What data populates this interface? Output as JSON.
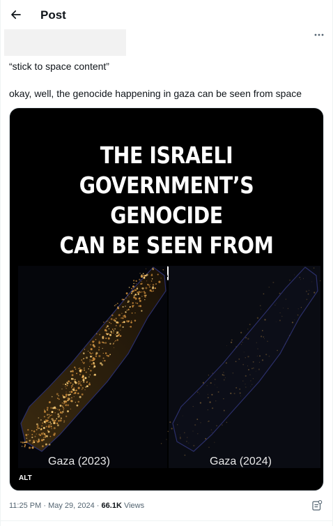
{
  "header": {
    "title": "Post",
    "back_icon": "arrow-left-icon"
  },
  "tweet": {
    "quote_line": "“stick to space content”",
    "body_line": "okay, well, the genocide happening in gaza can be seen from space",
    "more_icon": "more-dots-icon"
  },
  "media": {
    "headline_line1": "THE ISRAELI",
    "headline_line2": "GOVERNMENT’S GENOCIDE",
    "headline_line3": "CAN BE SEEN FROM SPACE",
    "label_left": "Gaza (2023)",
    "label_right": "Gaza (2024)",
    "alt_badge": "ALT",
    "left_map_brightness": "high",
    "right_map_brightness": "low"
  },
  "meta": {
    "time": "11:25 PM",
    "date": "May 29, 2024",
    "views_count": "66.1K",
    "views_label": "Views",
    "separator": "·",
    "analytics_icon": "analytics-icon"
  },
  "colors": {
    "text": "#0f1419",
    "secondary": "#536471",
    "media_bg": "#000000"
  }
}
